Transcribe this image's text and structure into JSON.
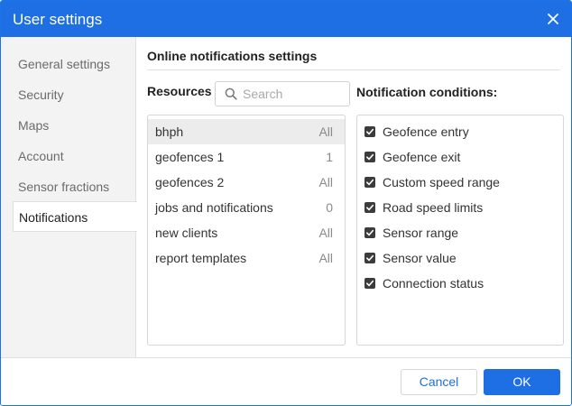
{
  "dialog": {
    "title": "User settings",
    "close_icon": "close-icon"
  },
  "sidebar": {
    "items": [
      {
        "label": "General settings"
      },
      {
        "label": "Security"
      },
      {
        "label": "Maps"
      },
      {
        "label": "Account"
      },
      {
        "label": "Sensor fractions"
      },
      {
        "label": "Notifications"
      }
    ],
    "active": "Notifications"
  },
  "main": {
    "section_title": "Online notifications settings",
    "resources_label": "Resources",
    "search": {
      "placeholder": "Search",
      "value": "",
      "icon": "search-icon"
    },
    "resources": [
      {
        "name": "bhph",
        "count": "All",
        "selected": true
      },
      {
        "name": "geofences 1",
        "count": "1"
      },
      {
        "name": "geofences 2",
        "count": "All"
      },
      {
        "name": "jobs and notifications",
        "count": "0"
      },
      {
        "name": "new clients",
        "count": "All"
      },
      {
        "name": "report templates",
        "count": "All"
      }
    ],
    "conditions_label": "Notification conditions:",
    "conditions": [
      {
        "label": "Geofence entry",
        "checked": true
      },
      {
        "label": "Geofence exit",
        "checked": true
      },
      {
        "label": "Custom speed range",
        "checked": true
      },
      {
        "label": "Road speed limits",
        "checked": true
      },
      {
        "label": "Sensor range",
        "checked": true
      },
      {
        "label": "Sensor value",
        "checked": true
      },
      {
        "label": "Connection status",
        "checked": true
      }
    ]
  },
  "footer": {
    "cancel_label": "Cancel",
    "ok_label": "OK"
  },
  "colors": {
    "accent": "#1e6fe3",
    "sidebar_bg": "#f3f3f3",
    "selected_row": "#ececec",
    "checkbox": "#3c3c3c"
  }
}
